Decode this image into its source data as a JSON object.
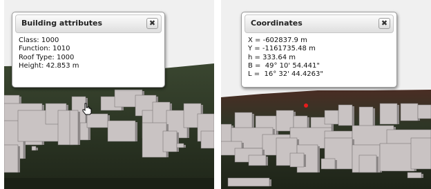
{
  "left_view": {
    "popup": {
      "title": "Building attributes",
      "close_glyph": "✖",
      "attributes": [
        "Class: 1000",
        "Function: 1010",
        "Roof Type: 1000",
        "Height: 42.853 m"
      ]
    },
    "cursor_icon": "hand-pointer-icon"
  },
  "right_view": {
    "popup": {
      "title": "Coordinates",
      "close_glyph": "✖",
      "lines": [
        "X = -602837.9 m",
        "Y = -1161735.48 m",
        "h = 333.64 m",
        "B =  49° 10' 54.441\"",
        "L =  16° 32' 44.4263\""
      ]
    },
    "marker_color": "#e81c1c"
  },
  "colors": {
    "sky": "#f0f0f0",
    "terrain_dark": "#2a3424",
    "building": "#c9c3c3",
    "building_side": "#8f8a8a"
  }
}
